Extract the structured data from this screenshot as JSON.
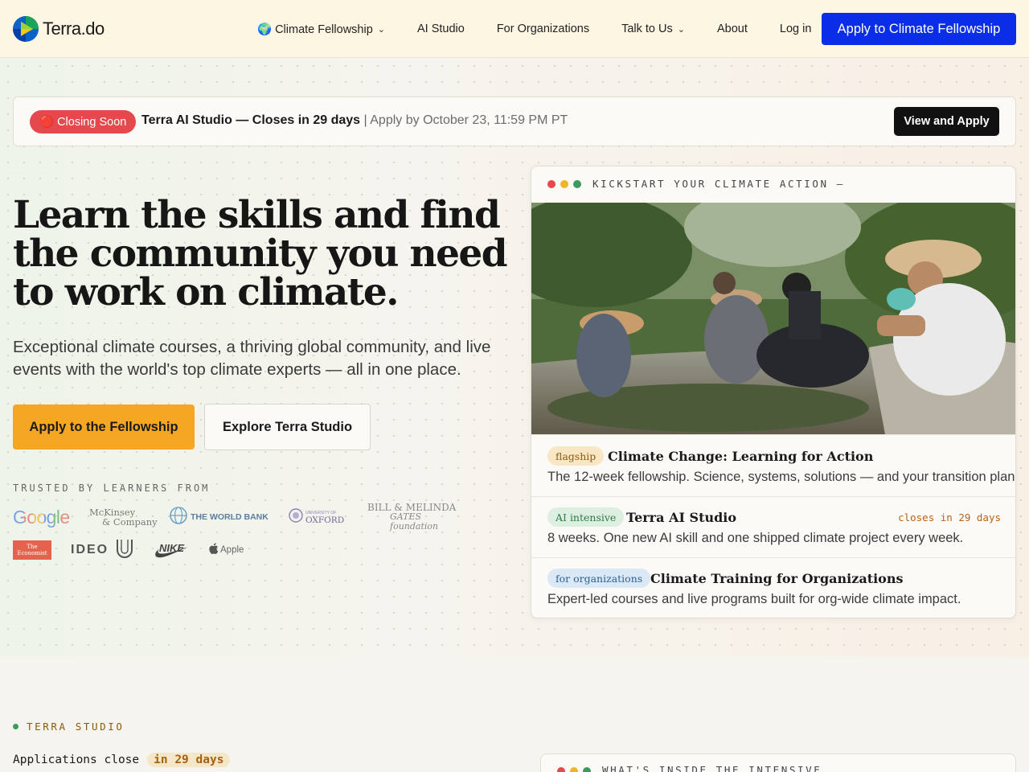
{
  "nav": {
    "logo_text": "Terra.do",
    "links": [
      {
        "label": "🌍 Climate Fellowship",
        "has_dropdown": true
      },
      {
        "label": "AI Studio",
        "has_dropdown": false
      },
      {
        "label": "For Organizations",
        "has_dropdown": false
      },
      {
        "label": "Talk to Us",
        "has_dropdown": true
      },
      {
        "label": "About",
        "has_dropdown": false
      },
      {
        "label": "Log in",
        "has_dropdown": false
      }
    ],
    "cta": "Apply to Climate Fellowship"
  },
  "banner": {
    "badge": "🔴 Closing Soon",
    "title": "Terra AI Studio — Closes in 29 days",
    "separator": "|",
    "deadline": "Apply by October 23, 11:59 PM PT",
    "button": "View and Apply"
  },
  "hero": {
    "title": "Learn the skills and find the community you need to work on climate.",
    "subtitle": "Exceptional climate courses, a thriving global community, and live events with the world's top climate experts — all in one place.",
    "primary_button": "Apply to the Fellowship",
    "secondary_button": "Explore Terra Studio",
    "trusted_label": "TRUSTED BY LEARNERS FROM",
    "logos": {
      "google": "Google",
      "mckinsey_1": "McKinsey",
      "mckinsey_2": "& Company",
      "worldbank": "THE WORLD BANK",
      "oxford_small": "UNIVERSITY OF",
      "oxford": "OXFORD",
      "gates_1": "BILL & MELINDA",
      "gates_2": "GATES foundation",
      "economist_1": "The",
      "economist_2": "Economist",
      "ideo": "IDEO",
      "nike": "NIKE",
      "apple": "Apple"
    }
  },
  "card": {
    "label": "KICKSTART YOUR CLIMATE ACTION —",
    "courses": [
      {
        "tag": "flagship",
        "title": "Climate Change: Learning for Action",
        "description": "The 12-week fellowship. Science, systems, solutions — and your transition plan.",
        "closes": ""
      },
      {
        "tag": "AI intensive",
        "title": "Terra AI Studio",
        "description": "8 weeks. One new AI skill and one shipped climate project every week.",
        "closes": "closes in 29 days"
      },
      {
        "tag": "for organizations",
        "title": "Climate Training for Organizations",
        "description": "Expert-led courses and live programs built for org-wide climate impact.",
        "closes": ""
      }
    ]
  },
  "studio": {
    "eyebrow": "TERRA STUDIO",
    "closes_prefix": "Applications close",
    "closes_pill": "in 29 days",
    "inside_label": "WHAT'S INSIDE THE INTENSIVE"
  },
  "colors": {
    "nav_bg": "#fdf6e3",
    "cta_blue": "#0a2ee8",
    "primary_orange": "#f5a623",
    "closing_red": "#e5484d",
    "accent_amber": "#b5651d"
  }
}
